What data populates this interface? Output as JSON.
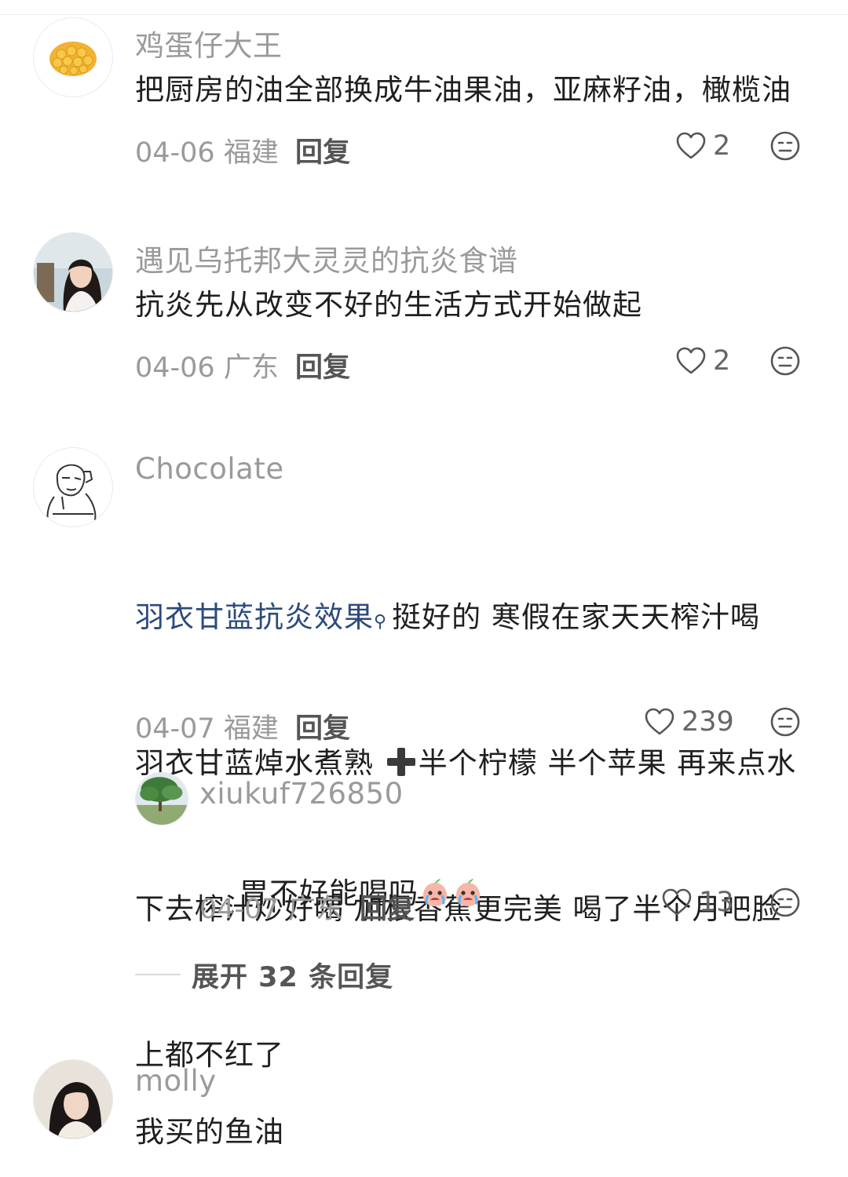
{
  "comments": [
    {
      "username": "鸡蛋仔大王",
      "text": "把厨房的油全部换成牛油果油，亚麻籽油，橄榄油",
      "date_location": "04-06 福建",
      "reply_label": "回复",
      "likes": "2"
    },
    {
      "username": "遇见乌托邦大灵灵的抗炎食谱",
      "text": "抗炎先从改变不好的生活方式开始做起",
      "date_location": "04-06 广东",
      "reply_label": "回复",
      "likes": "2"
    },
    {
      "username": "Chocolate",
      "tag_link": "羽衣甘蓝抗炎效果",
      "text_line1_rest": "挺好的 寒假在家天天榨汁喝",
      "text_line2_a": "羽衣甘蓝焯水煮熟 ",
      "text_line2_b": "半个柠檬 半个苹果 再来点水",
      "text_line3": "下去榨汁炒好喝 加根香蕉更完美 喝了半个月吧脸",
      "text_line4": "上都不红了",
      "date_location": "04-07 福建",
      "reply_label": "回复",
      "likes": "239",
      "reply": {
        "username": "xiukuf726850",
        "text": "胃不好能喝吗",
        "date_location": "04-07 广东",
        "reply_label": "回复",
        "likes": "13"
      },
      "expand_label": "展开 32 条回复"
    },
    {
      "username": "molly",
      "text": "我买的鱼油"
    }
  ],
  "icons": {
    "like": "heart-outline-icon",
    "dislike": "dislike-face-icon",
    "tag": "search-tag-icon",
    "emoji": "crying-peach-emoji",
    "plus": "heavy-plus-emoji"
  },
  "colors": {
    "link": "#2c4a7c",
    "muted": "#9a9a9a"
  }
}
